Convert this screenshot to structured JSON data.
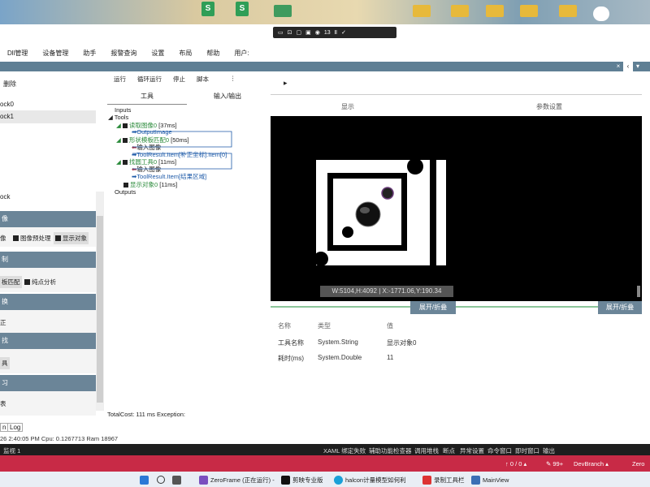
{
  "menu": [
    "Dll管理",
    "设备管理",
    "助手",
    "报警查询",
    "设置",
    "布局",
    "帮助",
    "用户:"
  ],
  "desktop_icons": {
    "s1": "S",
    "s2": "S"
  },
  "floatbar_count": "13",
  "topbar_controls": [
    "×",
    "‹",
    "▾"
  ],
  "left": {
    "delete_label": "删除",
    "items": [
      "ock0",
      "ock1",
      "ock"
    ],
    "sections": [
      {
        "title": "像",
        "chips": [
          "像",
          "图像预处理",
          "显示对象"
        ]
      },
      {
        "title": "制",
        "chips": [
          "板匹配",
          "纯点分析"
        ]
      },
      {
        "title": "换",
        "chips": [
          "正"
        ]
      },
      {
        "title": "找",
        "chips": [
          "具"
        ]
      },
      {
        "title": "习",
        "chips": [
          "表"
        ]
      }
    ]
  },
  "flow": {
    "toolbar": [
      "运行",
      "循环运行",
      "停止",
      "脚本",
      "⋮"
    ],
    "tabs": [
      "工具",
      "输入/输出"
    ],
    "tree": {
      "inputs": "Inputs",
      "tools": "Tools",
      "t1": "读取图像0",
      "t1_time": "[37ms]",
      "t1_out": "OutputImage",
      "t2": "形状模板匹配0",
      "t2_time": "[50ms]",
      "t2_in": "输入图像",
      "t2_out": "ToolResult.Item[补正坐标].Item[0]",
      "t3": "找圆工具0",
      "t3_time": "[11ms]",
      "t3_in": "输入图像",
      "t3_out": "ToolResult.Item[结果区域]",
      "t4": "显示对象0",
      "t4_time": "[11ms]",
      "outputs": "Outputs"
    },
    "total_cost": "TotalCost: 111 ms   Exception:"
  },
  "display": {
    "play": "▸",
    "tabs": [
      "显示",
      "参数设置"
    ],
    "readout": "W:5104,H:4092 | X:-1771.06,Y:190.34",
    "expand1": "展开/折叠",
    "expand2": "展开/折叠",
    "table_headers": [
      "名称",
      "类型",
      "值"
    ],
    "rows": [
      [
        "工具名称",
        "System.String",
        "显示对象0"
      ],
      [
        "耗时(ms)",
        "System.Double",
        "11"
      ]
    ]
  },
  "bottom": {
    "tabs": [
      "n",
      "Log"
    ],
    "status": "26 2:40:05 PM  Cpu: 0.1267713  Ram  18967",
    "ide_left": "监视 1",
    "ide_items": [
      "XAML 绑定失败",
      "辅助功能检查器",
      "调用堆栈",
      "断点",
      "异常设置",
      "命令窗口",
      "即时窗口",
      "输出"
    ],
    "git": "↑ 0 / 0 ▴",
    "git2": "✎ 99+",
    "branch": "DevBranch ▴",
    "zero": "Zero"
  },
  "taskbar": {
    "apps": [
      "ZeroFrame (正在运行) -",
      "剪映专业版",
      "halcon计量模型如何利",
      "录制工具栏",
      "MainView"
    ]
  }
}
